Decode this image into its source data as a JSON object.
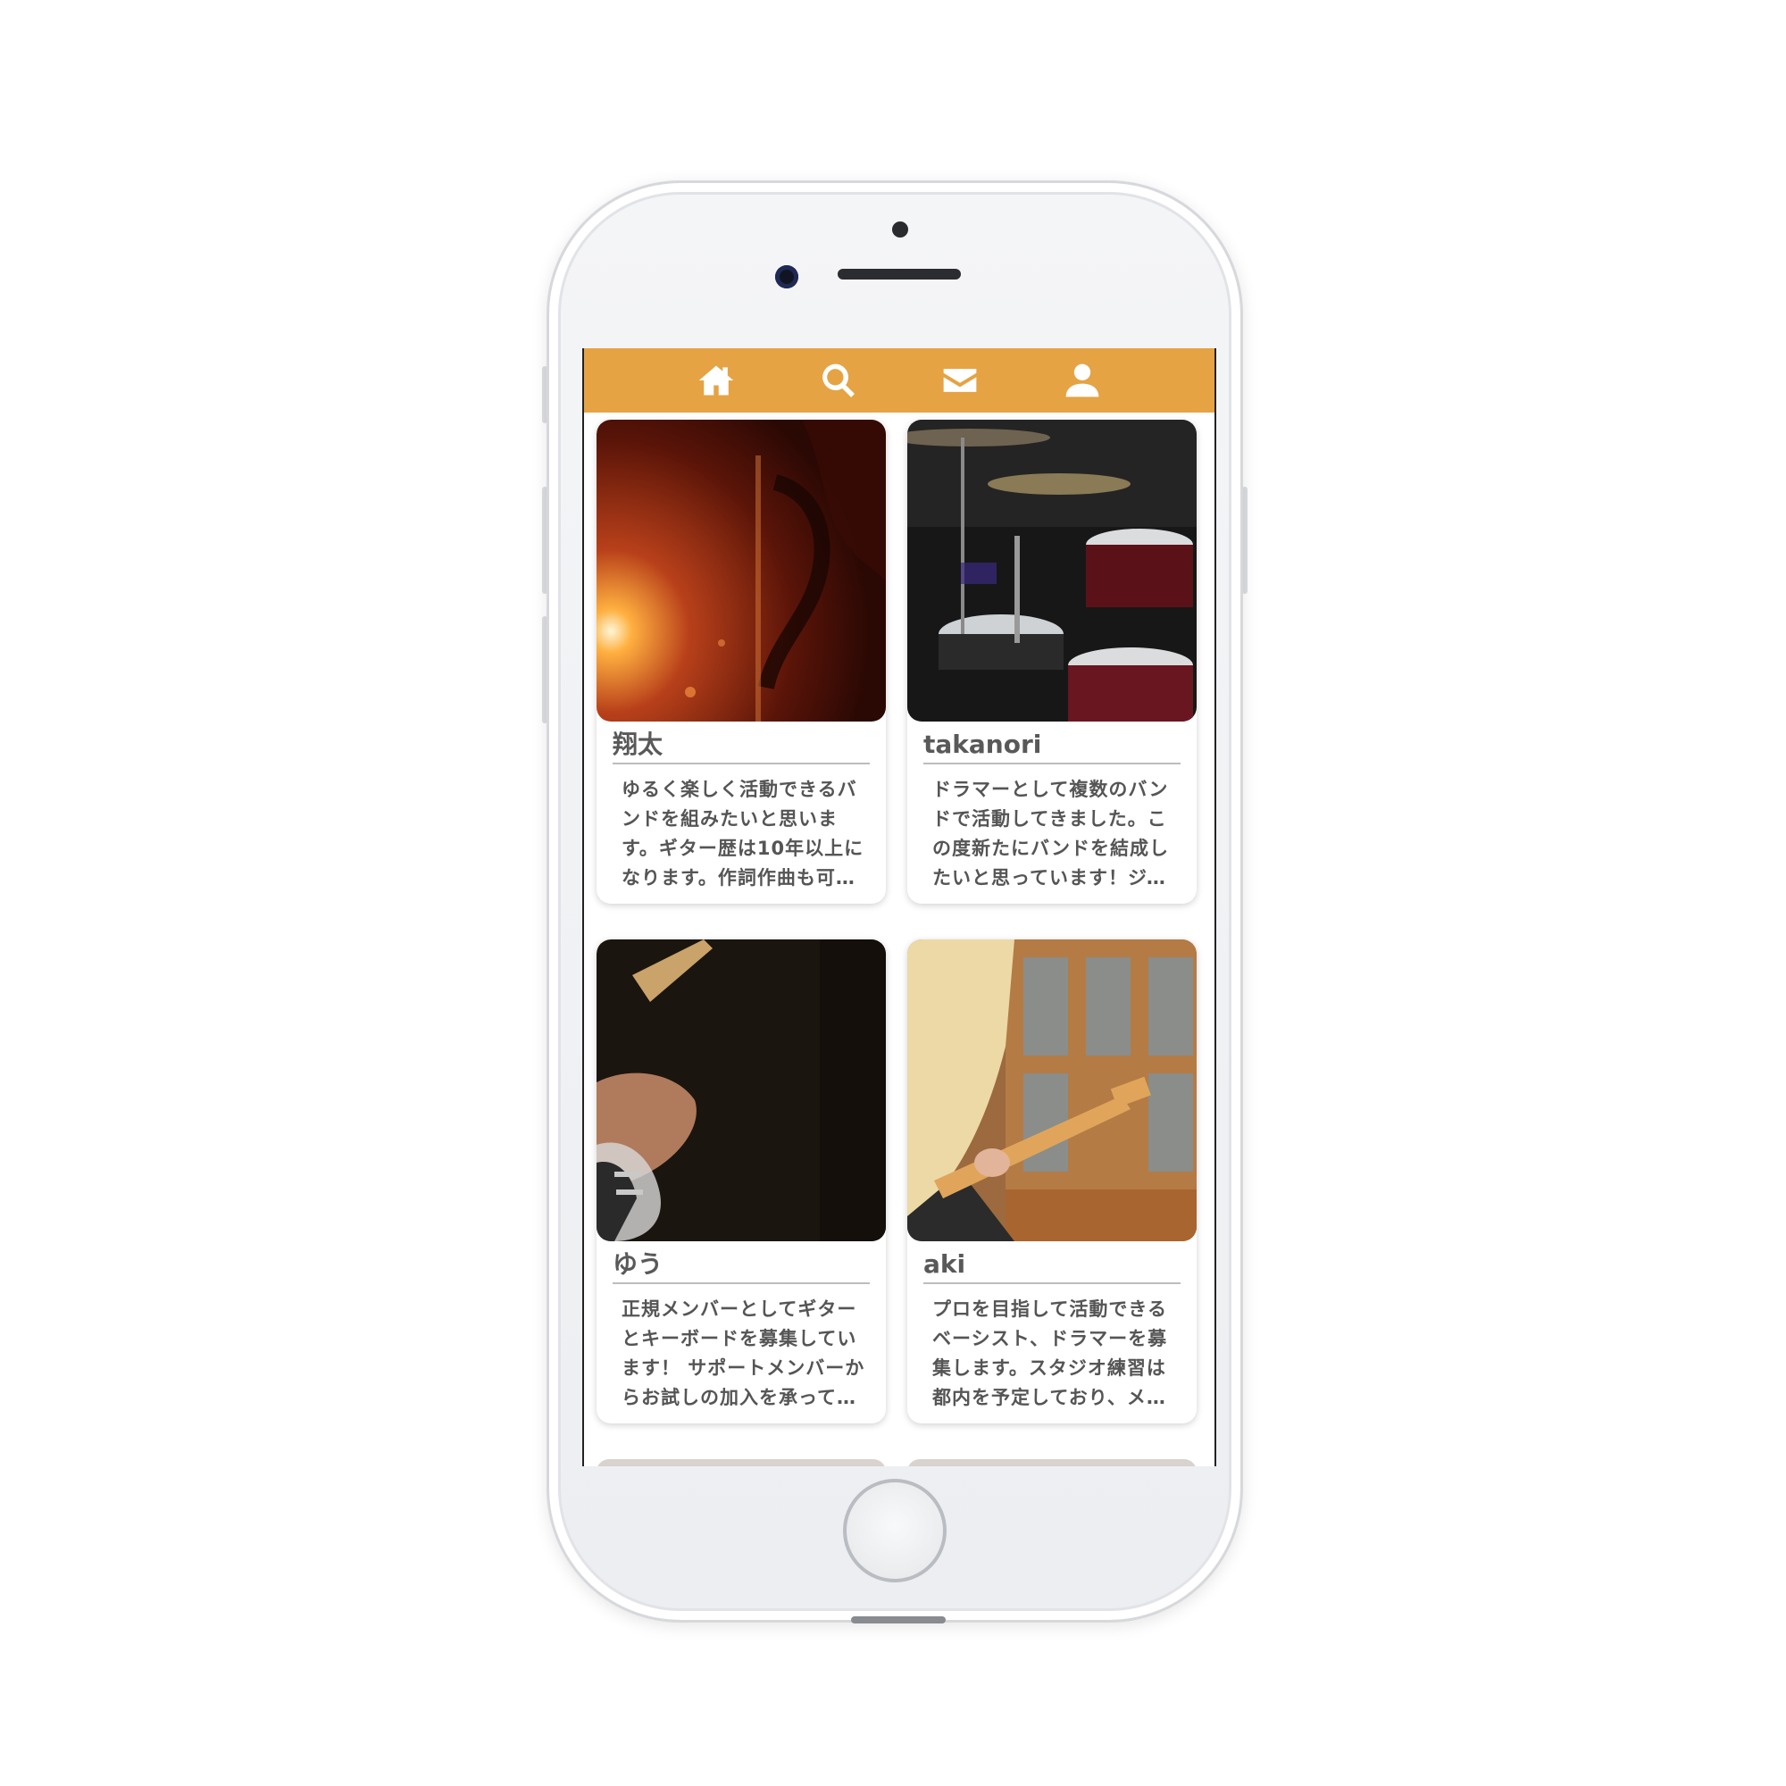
{
  "nav": {
    "items": [
      {
        "icon": "home-icon"
      },
      {
        "icon": "search-icon"
      },
      {
        "icon": "mail-icon"
      },
      {
        "icon": "user-icon"
      }
    ],
    "color": "#e5a344"
  },
  "cards": [
    {
      "name": "翔太",
      "text": "ゆるく楽しく活動できるバンドを組みたいと思います。ギター歴は10年以上になります。作詞作曲も可能です。"
    },
    {
      "name": "takanori",
      "text": "ドラマーとして複数のバンドで活動してきました。この度新たにバンドを結成したいと思っています！ジャンルは問いません。"
    },
    {
      "name": "ゆう",
      "text": "正規メンバーとしてギターとキーボードを募集しています！ サポートメンバーからお試しの加入を承っています。"
    },
    {
      "name": "aki",
      "text": "プロを目指して活動できるベーシスト、ドラマーを募集します。スタジオ練習は都内を予定しており、メンバー募集中です。"
    }
  ]
}
